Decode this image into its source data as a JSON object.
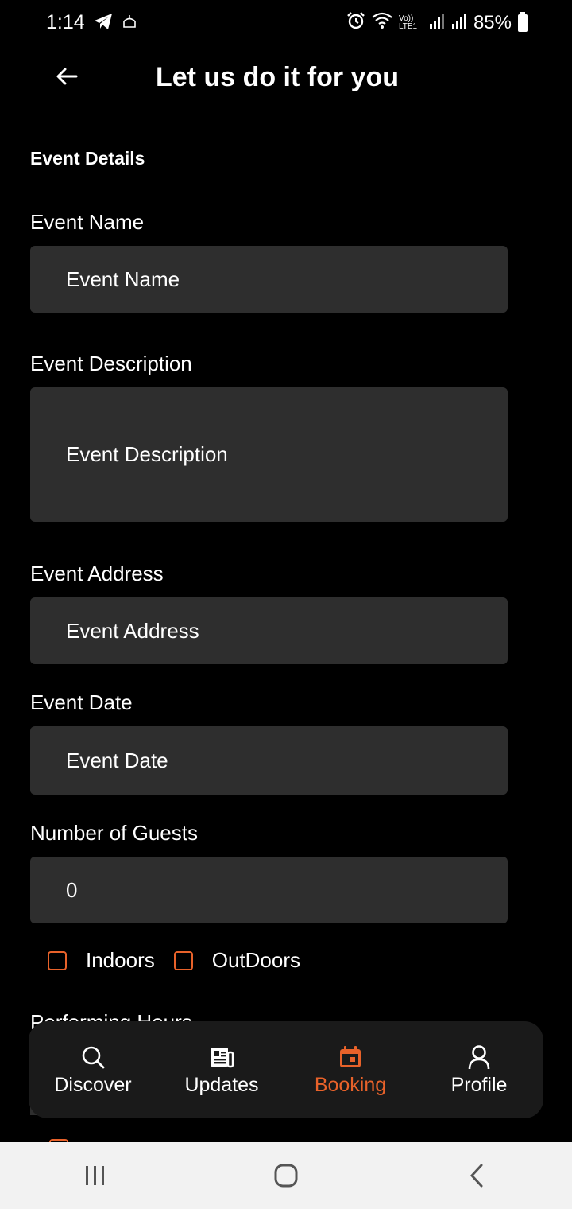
{
  "status_bar": {
    "time": "1:14",
    "battery": "85%",
    "network": "Vo)) LTE1"
  },
  "header": {
    "title": "Let us do it for you"
  },
  "form": {
    "section_title": "Event Details",
    "event_name": {
      "label": "Event Name",
      "placeholder": "Event Name"
    },
    "event_description": {
      "label": "Event Description",
      "placeholder": "Event Description"
    },
    "event_address": {
      "label": "Event Address",
      "placeholder": "Event Address"
    },
    "event_date": {
      "label": "Event Date",
      "placeholder": "Event Date"
    },
    "guests": {
      "label": "Number of Guests",
      "value": "0"
    },
    "indoors_label": "Indoors",
    "outdoors_label": "OutDoors",
    "next_section_label": "Performing Hours"
  },
  "bottom_nav": {
    "items": [
      {
        "label": "Discover",
        "icon": "search-icon"
      },
      {
        "label": "Updates",
        "icon": "newspaper-icon"
      },
      {
        "label": "Booking",
        "icon": "calendar-icon",
        "active": true
      },
      {
        "label": "Profile",
        "icon": "person-icon"
      }
    ]
  },
  "colors": {
    "accent": "#e8622a",
    "background": "#000000",
    "field": "#2e2e2e",
    "nav": "#1a1a1a"
  }
}
